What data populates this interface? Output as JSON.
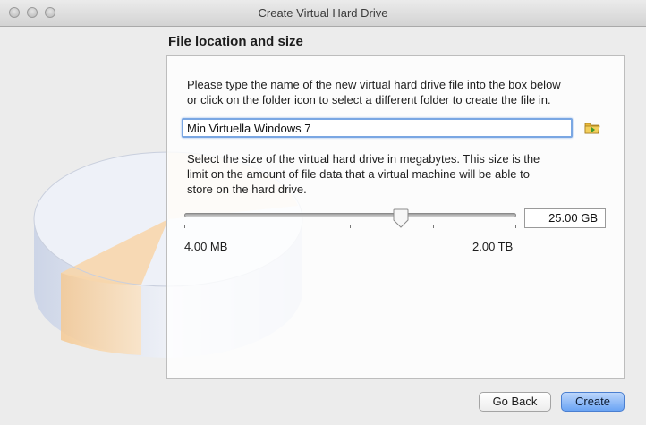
{
  "window": {
    "title": "Create Virtual Hard Drive"
  },
  "section": {
    "heading": "File location and size"
  },
  "location": {
    "instruction_line1": "Please type the name of the new virtual hard drive file into the box below",
    "instruction_line2": "or click on the folder icon to select a different folder to create the file in.",
    "file_name": "Min Virtuella Windows 7",
    "folder_icon": "folder-browse-icon"
  },
  "size": {
    "instruction_line1": "Select the size of the virtual hard drive in megabytes. This size is the",
    "instruction_line2": "limit on the amount of file data that a virtual machine will be able to",
    "instruction_line3": "store on the hard drive.",
    "value": "25.00 GB",
    "min_label": "4.00 MB",
    "max_label": "2.00 TB",
    "slider_fraction": 0.65
  },
  "buttons": {
    "back_label": "Go Back",
    "create_label": "Create"
  },
  "colors": {
    "default_button": "#6ba4f4",
    "focus_ring": "#7aa7e3"
  }
}
